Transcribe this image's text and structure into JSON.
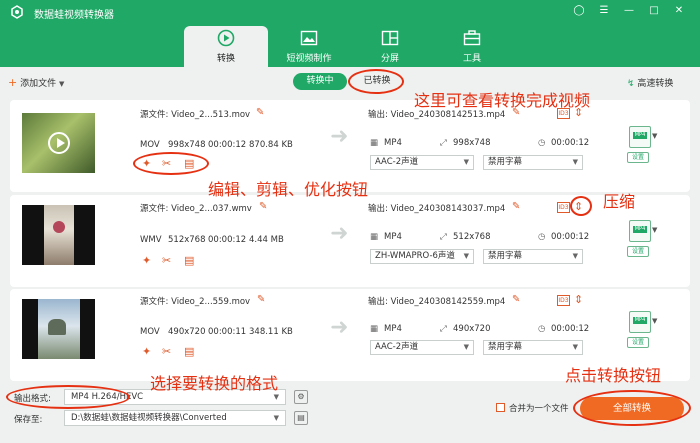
{
  "app": {
    "title": "数据蛙视频转换器"
  },
  "tabs": [
    {
      "label": "转换",
      "icon": "convert-icon",
      "active": true
    },
    {
      "label": "短视频制作",
      "icon": "picture-icon",
      "active": false
    },
    {
      "label": "分屏",
      "icon": "split-screen-icon",
      "active": false
    },
    {
      "label": "工具",
      "icon": "toolbox-icon",
      "active": false
    }
  ],
  "toolbar": {
    "add_files": "添加文件",
    "seg_converting": "转换中",
    "seg_done": "已转换",
    "fast_convert": "高速转换"
  },
  "files": [
    {
      "source_label": "源文件: Video_2...513.mov",
      "format": "MOV",
      "resolution": "998x748",
      "duration": "00:00:12",
      "size": "870.84 KB",
      "output_label": "输出: Video_240308142513.mp4",
      "out_format": "MP4",
      "out_resolution": "998x748",
      "out_duration": "00:00:12",
      "audio": "AAC-2声道",
      "subtitle": "禁用字幕",
      "preset_badge": "MP4",
      "settings": "设置"
    },
    {
      "source_label": "源文件: Video_2...037.wmv",
      "format": "WMV",
      "resolution": "512x768",
      "duration": "00:00:12",
      "size": "4.44 MB",
      "output_label": "输出: Video_240308143037.mp4",
      "out_format": "MP4",
      "out_resolution": "512x768",
      "out_duration": "00:00:12",
      "audio": "ZH-WMAPRO-6声道",
      "subtitle": "禁用字幕",
      "preset_badge": "MP4",
      "settings": "设置"
    },
    {
      "source_label": "源文件: Video_2...559.mov",
      "format": "MOV",
      "resolution": "490x720",
      "duration": "00:00:11",
      "size": "348.11 KB",
      "output_label": "输出: Video_240308142559.mp4",
      "out_format": "MP4",
      "out_resolution": "490x720",
      "out_duration": "00:00:12",
      "audio": "AAC-2声道",
      "subtitle": "禁用字幕",
      "preset_badge": "MP4",
      "settings": "设置"
    }
  ],
  "footer": {
    "output_format_label": "输出格式:",
    "output_format_value": "MP4 H.264/HEVC",
    "save_to_label": "保存至:",
    "save_to_value": "D:\\数据蛙\\数据蛙视频转换器\\Converted",
    "merge_label": "合并为一个文件",
    "convert_all": "全部转换"
  },
  "annotations": {
    "view_done": "这里可查看转换完成视频",
    "edit_tools": "编辑、剪辑、优化按钮",
    "compress": "压缩",
    "choose_format": "选择要转换的格式",
    "click_convert": "点击转换按钮"
  },
  "colors": {
    "brand_green": "#1fa866",
    "accent_orange": "#f06a23",
    "annotation_red": "#e53012"
  }
}
